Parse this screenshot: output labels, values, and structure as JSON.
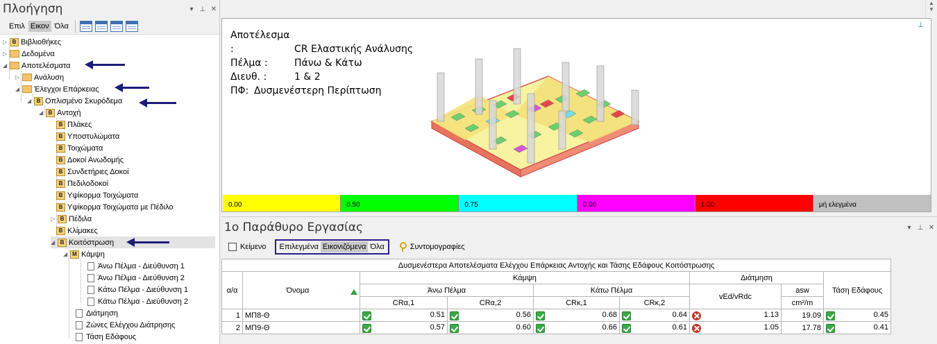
{
  "nav": {
    "title": "Πλοήγηση",
    "tabs": [
      "Επιλ",
      "Εικον",
      "Όλα"
    ],
    "tree": [
      {
        "label": "Βιβλιοθήκες",
        "icon": "B"
      },
      {
        "label": "Δεδομένα",
        "icon": "folder"
      },
      {
        "label": "Αποτελέσματα",
        "icon": "folder"
      },
      {
        "label": "Ανάλυση",
        "icon": "folder"
      },
      {
        "label": "Έλεγχοι Επάρκειας",
        "icon": "folder"
      },
      {
        "label": "Οπλισμένο Σκυρόδεμα",
        "icon": "B"
      },
      {
        "label": "Αντοχή",
        "icon": "B"
      },
      {
        "label": "Πλάκες",
        "icon": "B"
      },
      {
        "label": "Υποστυλώματα",
        "icon": "B"
      },
      {
        "label": "Τοιχώματα",
        "icon": "B"
      },
      {
        "label": "Δοκοί Ανωδομής",
        "icon": "B"
      },
      {
        "label": "Συνδετήριες Δοκοί",
        "icon": "B"
      },
      {
        "label": "Πεδιλοδοκοί",
        "icon": "B"
      },
      {
        "label": "Υψίκορμα Τοιχώματα",
        "icon": "B"
      },
      {
        "label": "Υψίκορμα Τοιχώματα με Πέδιλο",
        "icon": "B"
      },
      {
        "label": "Πέδιλα",
        "icon": "B"
      },
      {
        "label": "Κλίμακες",
        "icon": "B"
      },
      {
        "label": "Κοιτόστρωση",
        "icon": "B"
      },
      {
        "label": "Κάμψη",
        "icon": "M"
      },
      {
        "label": "Άνω Πέλμα - Διεύθυνση 1",
        "icon": "doc"
      },
      {
        "label": "Άνω Πέλμα - Διεύθυνση 2",
        "icon": "doc"
      },
      {
        "label": "Κάτω Πέλμα - Διεύθυνση 1",
        "icon": "doc"
      },
      {
        "label": "Κάτω Πέλμα - Διεύθυνση 2",
        "icon": "doc"
      },
      {
        "label": "Διάτμηση",
        "icon": "doc"
      },
      {
        "label": "Ζώνες Ελέγχου Διάτρησης",
        "icon": "doc"
      },
      {
        "label": "Τάση Εδάφους",
        "icon": "doc"
      }
    ]
  },
  "viewport": {
    "lines": [
      {
        "label": "Αποτέλεσμα :",
        "value": "CR Ελαστικής Ανάλυσης"
      },
      {
        "label": "Πέλμα :",
        "value": "Πάνω & Κάτω"
      },
      {
        "label": "Διευθ. :",
        "value": "1 & 2"
      },
      {
        "label": "ΠΦ:",
        "value": "Δυσμενέστερη Περίπτωση"
      }
    ],
    "scale": [
      {
        "label": "0.00",
        "color": "#ffff00"
      },
      {
        "label": "0.50",
        "color": "#00ff00"
      },
      {
        "label": "0.75",
        "color": "#00ffff"
      },
      {
        "label": "0.90",
        "color": "#ff00ff"
      },
      {
        "label": "1.00",
        "color": "#ff0000"
      },
      {
        "label": "μή ελεγμένα",
        "color": "#c0c0c0"
      }
    ]
  },
  "work": {
    "title": "1ο Παράθυρο Εργασίας",
    "text_button": "Κείμενο",
    "filters": [
      "Επιλεγμένα",
      "Εικονιζόμενα",
      "Όλα"
    ],
    "shortcuts": "Συντομογραφίες",
    "table": {
      "caption": "Δυσμενέστερα Αποτελέσματα Ελέγχου Επάρκειας Αντοχής και Τάσης Εδάφους Κοιτόστρωσης",
      "h_aa": "α/α",
      "h_name": "Όνομα",
      "h_bending": "Κάμψη",
      "h_shear": "Διάτμηση",
      "h_soil": "Τάση Εδάφους",
      "h_top": "Άνω Πέλμα",
      "h_bottom": "Κάτω Πέλμα",
      "h_ved": "vEd/vRdc",
      "h_asw": "asw",
      "h_asw_unit": "cm²/m",
      "h_cra1": "CRα,1",
      "h_cra2": "CRα,2",
      "h_crk1": "CRκ,1",
      "h_crk2": "CRκ,2",
      "rows": [
        {
          "n": "1",
          "name": "ΜΠ8-Θ",
          "cra1": "0.51",
          "cra2": "0.56",
          "crk1": "0.68",
          "crk2": "0.64",
          "ved": "1.13",
          "asw": "19.09",
          "soil": "0.45"
        },
        {
          "n": "2",
          "name": "ΜΠ9-Θ",
          "cra1": "0.57",
          "cra2": "0.60",
          "crk1": "0.66",
          "crk2": "0.61",
          "ved": "1.05",
          "asw": "17.78",
          "soil": "0.41"
        }
      ]
    }
  }
}
